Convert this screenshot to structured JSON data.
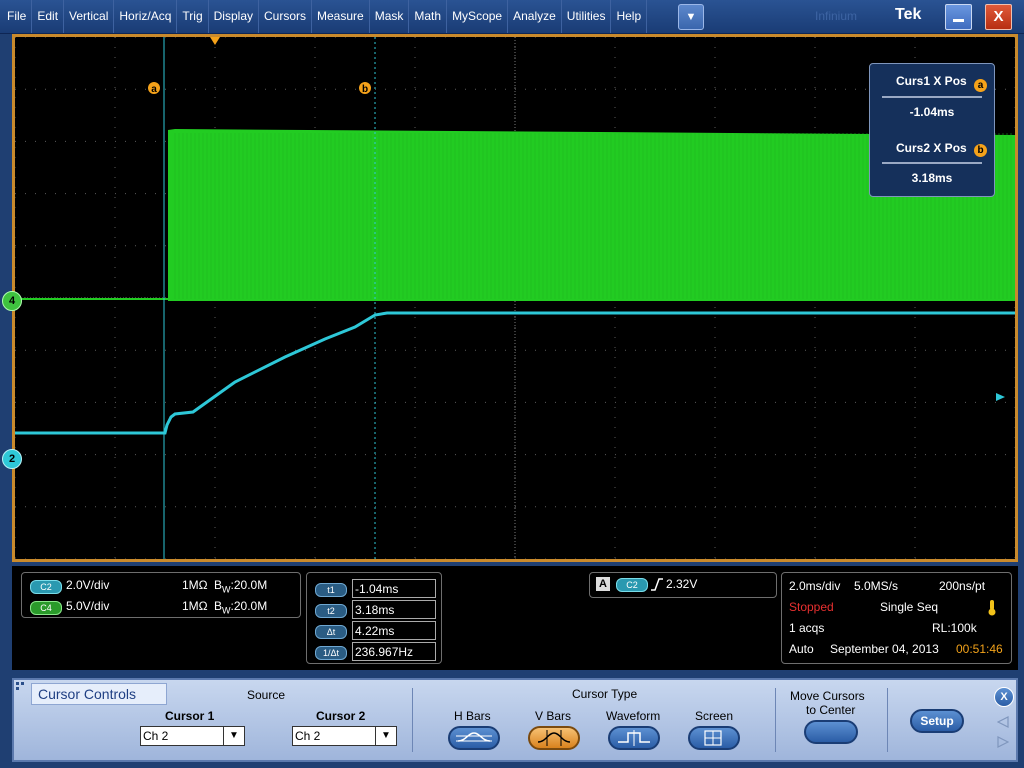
{
  "menu": {
    "items": [
      "File",
      "Edit",
      "Vertical",
      "Horiz/Acq",
      "Trig",
      "Display",
      "Cursors",
      "Measure",
      "Mask",
      "Math",
      "MyScope",
      "Analyze",
      "Utilities",
      "Help"
    ],
    "dropdown_icon": "▼",
    "brand": "Tek",
    "brand_ghost": "Infinium",
    "close_label": "X"
  },
  "display": {
    "ch4_marker": "4",
    "ch2_marker": "2",
    "cursor_a_label": "a",
    "cursor_b_label": "b",
    "colors": {
      "ch2": "#2ec8d8",
      "ch4": "#22cc22",
      "cursor": "#f5a21a",
      "grid": "#5a5a5a"
    }
  },
  "cursor_readout": {
    "curs1_label": "Curs1 X Pos",
    "curs1_badge": "a",
    "curs1_value": "-1.04ms",
    "curs2_label": "Curs2 X Pos",
    "curs2_badge": "b",
    "curs2_value": "3.18ms"
  },
  "channels": {
    "c2": {
      "badge": "C2",
      "scale": "2.0V/div",
      "impedance": "1MΩ",
      "bw_prefix": "B",
      "bw_sub": "W",
      "bw": ":20.0M"
    },
    "c4": {
      "badge": "C4",
      "scale": "5.0V/div",
      "impedance": "1MΩ",
      "bw_prefix": "B",
      "bw_sub": "W",
      "bw": ":20.0M"
    }
  },
  "measurements": {
    "t1_label": "t1",
    "t1": "-1.04ms",
    "t2_label": "t2",
    "t2": "3.18ms",
    "dt_label": "Δt",
    "dt": "4.22ms",
    "inv_label": "1/Δt",
    "inv": "236.967Hz"
  },
  "trigger": {
    "mode_badge": "A",
    "source_badge": "C2",
    "level": "2.32V"
  },
  "acquisition": {
    "timebase": "2.0ms/div",
    "sample_rate": "5.0MS/s",
    "resolution": "200ns/pt",
    "state": "Stopped",
    "mode": "Single Seq",
    "acqs": "1 acqs",
    "record_length": "RL:100k",
    "trigger_mode": "Auto",
    "date": "September 04, 2013",
    "time": "00:51:46"
  },
  "cursor_controls": {
    "title": "Cursor Controls",
    "source_label": "Source",
    "cursor1_label": "Cursor 1",
    "cursor1_value": "Ch 2",
    "cursor2_label": "Cursor 2",
    "cursor2_value": "Ch 2",
    "type_label": "Cursor Type",
    "types": [
      "H Bars",
      "V Bars",
      "Waveform",
      "Screen"
    ],
    "active_type": "V Bars",
    "move_label_1": "Move Cursors",
    "move_label_2": "to Center",
    "setup_label": "Setup",
    "close_label": "X"
  }
}
